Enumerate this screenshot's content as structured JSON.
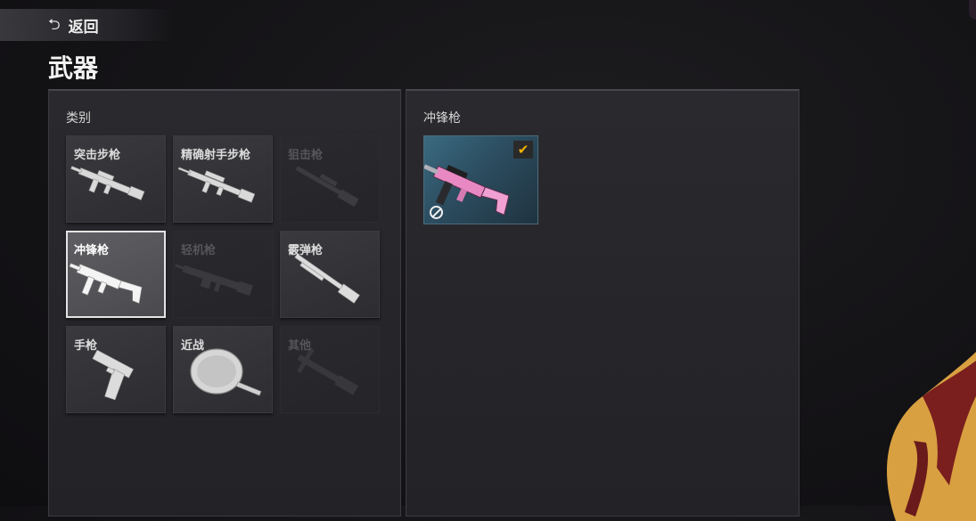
{
  "header": {
    "back_label": "返回",
    "back_icon": "undo-arrow-icon",
    "title": "武器"
  },
  "category_panel": {
    "heading": "类别",
    "tiles": [
      {
        "label": "突击步枪",
        "icon": "assault-rifle-icon",
        "state": "enabled"
      },
      {
        "label": "精确射手步枪",
        "icon": "marksman-rifle-icon",
        "state": "enabled"
      },
      {
        "label": "狙击枪",
        "icon": "sniper-rifle-icon",
        "state": "disabled"
      },
      {
        "label": "冲锋枪",
        "icon": "smg-icon",
        "state": "selected"
      },
      {
        "label": "轻机枪",
        "icon": "lmg-icon",
        "state": "disabled"
      },
      {
        "label": "霰弹枪",
        "icon": "shotgun-icon",
        "state": "enabled"
      },
      {
        "label": "手枪",
        "icon": "pistol-icon",
        "state": "enabled"
      },
      {
        "label": "近战",
        "icon": "pan-icon",
        "state": "enabled"
      },
      {
        "label": "其他",
        "icon": "crossbow-icon",
        "state": "disabled"
      }
    ]
  },
  "skins_panel": {
    "heading": "冲锋枪",
    "items": [
      {
        "icon": "pink-smg-skin-icon",
        "equipped": true,
        "badge_icon": "checkmark-icon",
        "status_icon": "prohibited-icon",
        "accent_color": "#f5b400"
      }
    ]
  },
  "colors": {
    "accent": "#f5b400",
    "skin_pink": "#e889c4"
  }
}
